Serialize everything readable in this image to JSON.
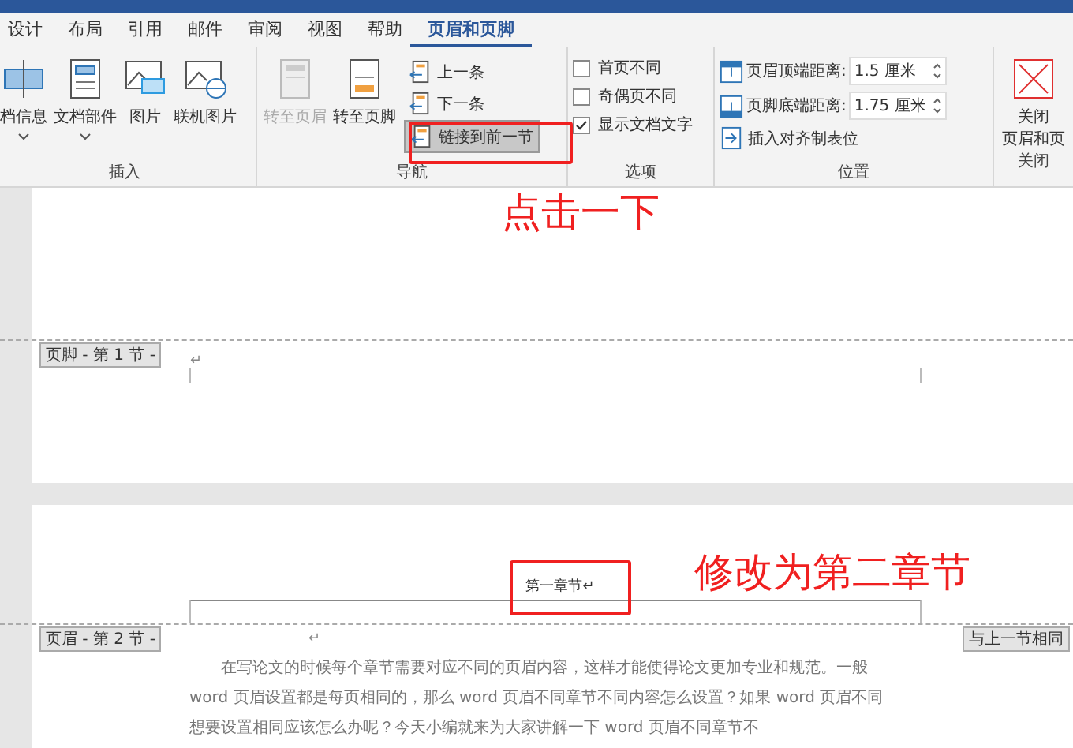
{
  "tabs": [
    {
      "label": "设计",
      "selected": false
    },
    {
      "label": "布局",
      "selected": false
    },
    {
      "label": "引用",
      "selected": false
    },
    {
      "label": "邮件",
      "selected": false
    },
    {
      "label": "审阅",
      "selected": false
    },
    {
      "label": "视图",
      "selected": false
    },
    {
      "label": "帮助",
      "selected": false
    },
    {
      "label": "页眉和页脚",
      "selected": true
    }
  ],
  "insert_group": {
    "label": "插入",
    "buttons": [
      {
        "label": "档信息",
        "dropdown": true
      },
      {
        "label": "文档部件",
        "dropdown": true
      },
      {
        "label": "图片",
        "dropdown": false
      },
      {
        "label": "联机图片",
        "dropdown": false
      }
    ]
  },
  "navigation_group": {
    "label": "导航",
    "large_buttons": [
      {
        "label": "转至页眉",
        "disabled": true
      },
      {
        "label": "转至页脚",
        "disabled": false
      }
    ],
    "small_buttons": [
      {
        "label": "上一条",
        "selected": false
      },
      {
        "label": "下一条",
        "selected": false
      },
      {
        "label": "链接到前一节",
        "selected": true
      }
    ]
  },
  "options_group": {
    "label": "选项",
    "checkboxes": [
      {
        "label": "首页不同",
        "checked": false
      },
      {
        "label": "奇偶页不同",
        "checked": false
      },
      {
        "label": "显示文档文字",
        "checked": true
      }
    ]
  },
  "position_group": {
    "label": "位置",
    "fields": [
      {
        "label": "页眉顶端距离:",
        "value": "1.5 厘米"
      },
      {
        "label": "页脚底端距离:",
        "value": "1.75 厘米"
      }
    ],
    "insert_tab": "插入对齐制表位"
  },
  "close_group": {
    "label": "关闭",
    "button_lines": [
      "关闭",
      "页眉和页"
    ]
  },
  "document": {
    "footer_label": "页脚 - 第 1 节 -",
    "footer_mark": "↵",
    "header_text": "第一章节↵",
    "header_label": "页眉 - 第 2 节 -",
    "body_mark": "↵",
    "same_as_previous": "与上一节相同",
    "paragraph": "在写论文的时候每个章节需要对应不同的页眉内容，这样才能使得论文更加专业和规范。一般 word 页眉设置都是每页相同的，那么 word 页眉不同章节不同内容怎么设置？如果 word 页眉不同想要设置相同应该怎么办呢？今天小编就来为大家讲解一下 word 页眉不同章节不"
  },
  "annotations": [
    "点击一下",
    "修改为第二章节"
  ]
}
